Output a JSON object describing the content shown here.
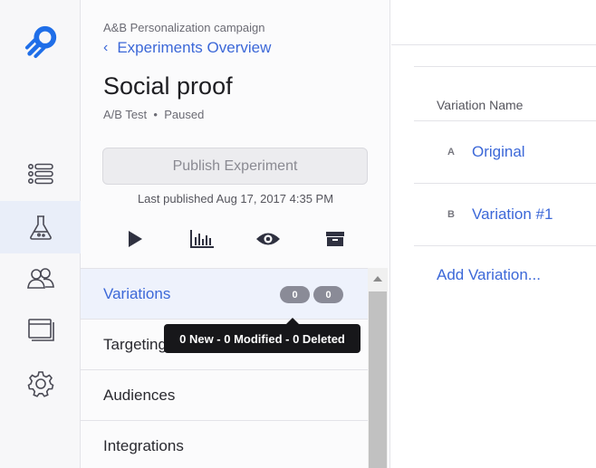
{
  "colors": {
    "accent": "#3c68d8",
    "badge": "#8a8b97",
    "tooltip": "#17171a",
    "active_rail": "#e9eef9"
  },
  "rail": {
    "logo": "optimizely-logo",
    "items": [
      {
        "icon": "list-icon"
      },
      {
        "icon": "flask-icon",
        "active": true
      },
      {
        "icon": "audiences-icon"
      },
      {
        "icon": "browser-window-icon"
      },
      {
        "icon": "gear-icon"
      }
    ]
  },
  "experiment": {
    "campaign": "A&B Personalization campaign",
    "breadcrumb": "Experiments Overview",
    "title": "Social proof",
    "type": "A/B Test",
    "status": "Paused",
    "publish_label": "Publish Experiment",
    "last_published": "Last published Aug 17, 2017 4:35 PM",
    "toolbar": [
      "play-icon",
      "results-chart-icon",
      "preview-eye-icon",
      "archive-icon"
    ]
  },
  "nav": {
    "items": [
      {
        "label": "Variations",
        "selected": true,
        "badges": [
          "0",
          "0"
        ]
      },
      {
        "label": "Targeting"
      },
      {
        "label": "Audiences"
      },
      {
        "label": "Integrations"
      }
    ]
  },
  "tooltip": "0 New - 0 Modified - 0 Deleted",
  "variations": {
    "column_header": "Variation Name",
    "rows": [
      {
        "letter": "A",
        "name": "Original"
      },
      {
        "letter": "B",
        "name": "Variation #1"
      }
    ],
    "add_label": "Add Variation..."
  }
}
